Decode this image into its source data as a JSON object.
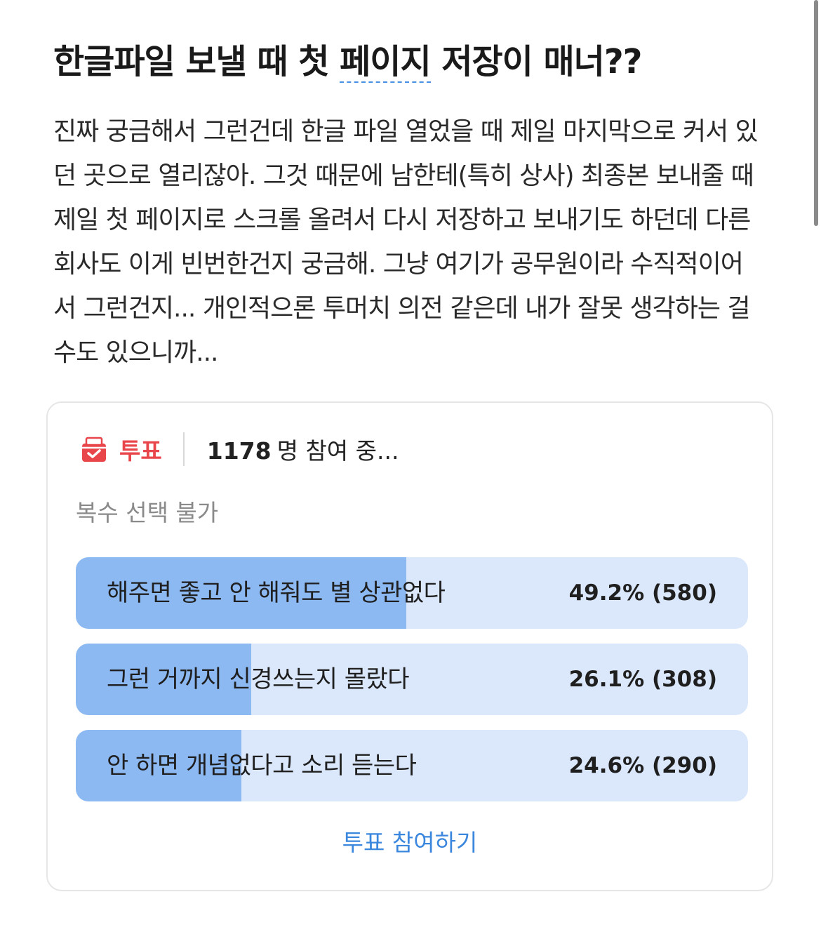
{
  "post": {
    "title_before": "한글파일 보낼 때 첫 ",
    "title_link": "페이지",
    "title_after": " 저장이 매너??",
    "body": "진짜 궁금해서 그런건데 한글 파일 열었을 때 제일 마지막으로 커서 있던 곳으로 열리잖아. 그것 때문에 남한테(특히 상사) 최종본 보내줄 때 제일 첫 페이지로 스크롤 올려서 다시 저장하고 보내기도 하던데 다른 회사도 이게 빈번한건지 궁금해. 그냥 여기가 공무원이라 수직적이어서 그런건지... 개인적으론 투머치 의전 같은데 내가 잘못 생각하는 걸수도 있으니까..."
  },
  "poll": {
    "label": "투표",
    "participant_count": "1178",
    "participant_suffix": "명 참여 중...",
    "mode": "복수 선택 불가",
    "options": [
      {
        "text": "해주면 좋고 안 해줘도 별 상관없다",
        "percent": 49.2,
        "result": "49.2% (580)"
      },
      {
        "text": "그런 거까지 신경쓰는지 몰랐다",
        "percent": 26.1,
        "result": "26.1% (308)"
      },
      {
        "text": "안 하면 개념없다고 소리 듣는다",
        "percent": 24.6,
        "result": "24.6% (290)"
      }
    ],
    "vote_button": "투표 참여하기",
    "icon": "ballot-box-icon",
    "colors": {
      "accent_red": "#e8464b",
      "bar_track": "#dbe8fb",
      "bar_fill": "#8db9f3",
      "button_blue": "#3b87dd"
    }
  }
}
